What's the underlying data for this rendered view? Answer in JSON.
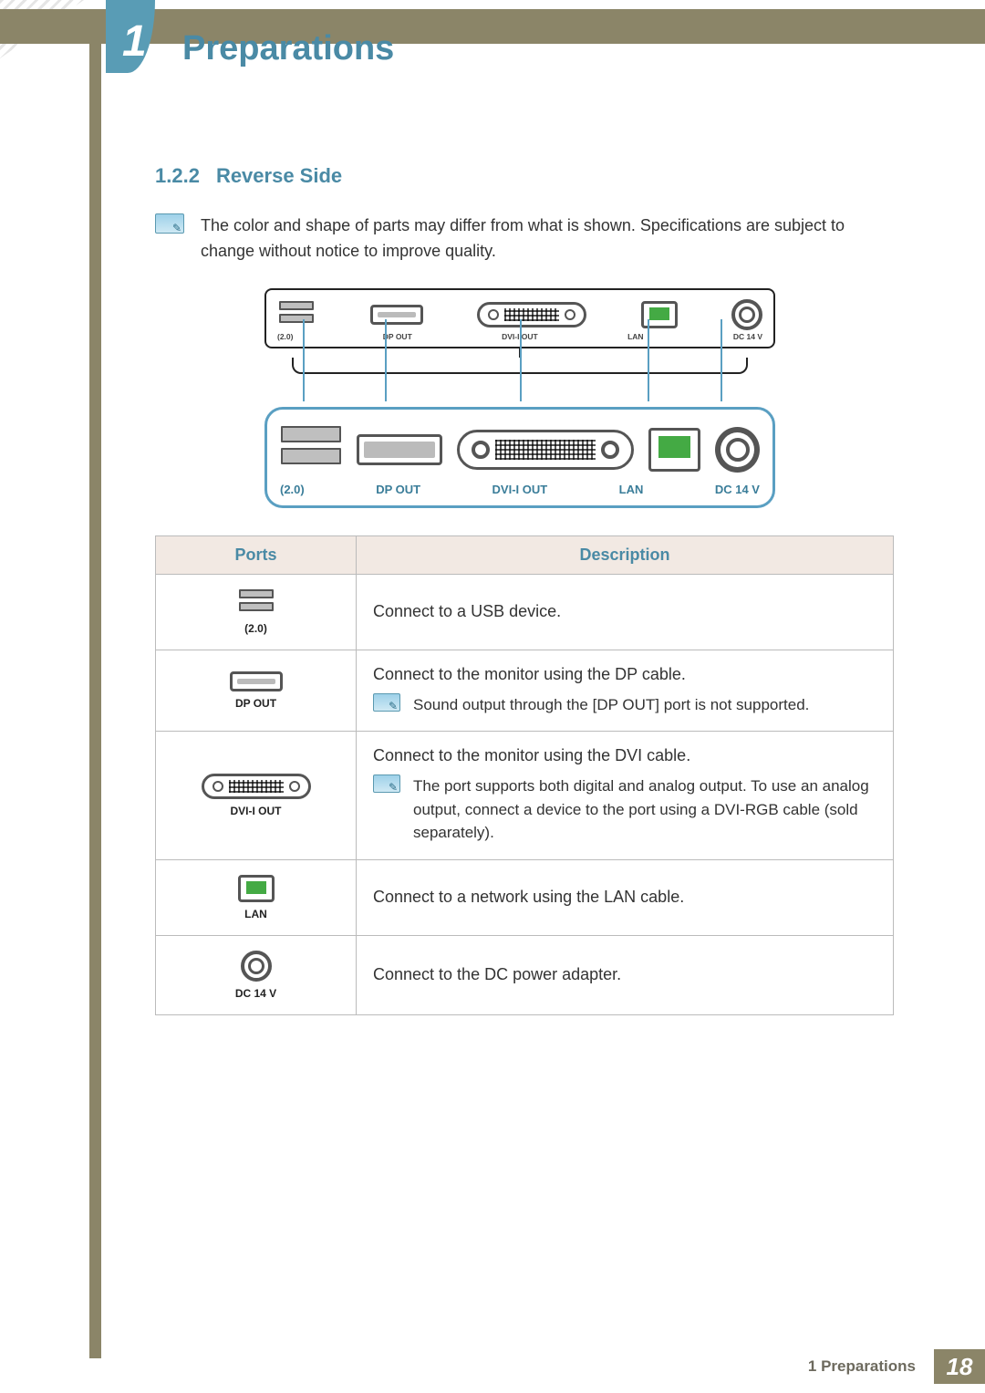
{
  "header": {
    "chapter_number": "1",
    "page_title": "Preparations"
  },
  "section": {
    "number": "1.2.2",
    "title": "Reverse Side"
  },
  "intro_note": "The color and shape of parts may differ from what is shown. Specifications are subject to change without notice to improve quality.",
  "diagram": {
    "mini_labels": {
      "usb": "(2.0)",
      "dp": "DP OUT",
      "dvi": "DVI-I OUT",
      "lan": "LAN",
      "dc": "DC 14 V"
    },
    "zoom_labels": {
      "usb": "(2.0)",
      "dp": "DP OUT",
      "dvi": "DVI-I OUT",
      "lan": "LAN",
      "dc": "DC 14 V"
    }
  },
  "table": {
    "headers": {
      "ports": "Ports",
      "description": "Description"
    },
    "rows": [
      {
        "port_caption": "(2.0)",
        "description": "Connect to a USB device.",
        "note": null
      },
      {
        "port_caption": "DP OUT",
        "description": "Connect to the monitor using the DP cable.",
        "note": "Sound output through the [DP OUT] port is not supported."
      },
      {
        "port_caption": "DVI-I OUT",
        "description": "Connect to the monitor using the DVI cable.",
        "note": "The port supports both digital and analog output. To use an analog output, connect a device to the port using a DVI-RGB cable (sold separately)."
      },
      {
        "port_caption": "LAN",
        "description": "Connect to a network using the LAN cable.",
        "note": null
      },
      {
        "port_caption": "DC 14 V",
        "description": "Connect to the DC power adapter.",
        "note": null
      }
    ]
  },
  "footer": {
    "breadcrumb": "1 Preparations",
    "page_number": "18"
  }
}
